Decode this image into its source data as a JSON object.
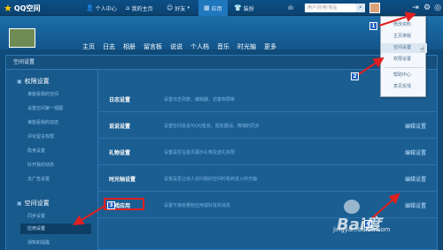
{
  "topbar": {
    "logo": "QQ空间",
    "nav": [
      {
        "label": "个人中心",
        "icon": "person-icon"
      },
      {
        "label": "我的主页",
        "icon": "house-icon"
      },
      {
        "label": "好友",
        "icon": "friends-icon"
      },
      {
        "label": "应用",
        "icon": "grid-icon"
      },
      {
        "label": "装扮",
        "icon": "shirt-icon"
      }
    ],
    "search_placeholder": "用户/应用/商品",
    "search_icon": "search-icon"
  },
  "banner": {
    "nav": [
      "主页",
      "日志",
      "相册",
      "留言板",
      "说说",
      "个人档",
      "音乐",
      "时光轴",
      "更多"
    ]
  },
  "dropdown": {
    "items": [
      "修改资料",
      "主页排版",
      "空间设置",
      "权限设置",
      "帮助中心",
      "意见反馈"
    ],
    "hovered": "空间设置"
  },
  "panel": {
    "title": "空间设置"
  },
  "sidebar": {
    "sections": [
      {
        "label": "权限设置",
        "items": [
          "谁能看我的空间",
          "设置空间第一视图",
          "谁能看我的动态",
          "评论留言权限",
          "隐身设置",
          "好开我的动态",
          "去广告设置"
        ]
      },
      {
        "label": "空间设置",
        "items": [
          "同步设置",
          "应用设置",
          "通知和提醒"
        ]
      }
    ],
    "selected": "应用设置"
  },
  "rows": [
    {
      "title": "日志设置",
      "desc": "设置日志列表、编辑器、访客权限等",
      "edit": ""
    },
    {
      "title": "说说设置",
      "desc": "设置空间说说与QQ签名、朋友圈消、微博的同步",
      "edit": "编辑设置"
    },
    {
      "title": "礼物设置",
      "desc": "设置是否在首页展示礼物及送礼权限",
      "edit": "编辑设置"
    },
    {
      "title": "时光轴设置",
      "desc": "设置是否让他人访问我的空间时看到进入时光轴",
      "edit": "编辑设置"
    },
    {
      "title": "游戏应用",
      "desc": "设置不接受哪些应用或好友的消息",
      "edit": "编辑设置"
    }
  ],
  "annotations": [
    "1",
    "2",
    "3",
    "4"
  ],
  "watermark": {
    "text": "jingyan.baidu.com",
    "logo": "Bai度"
  },
  "colors": {
    "accent": "#1f77bd",
    "highlight": "#e02020",
    "arrow": "#e02020"
  }
}
